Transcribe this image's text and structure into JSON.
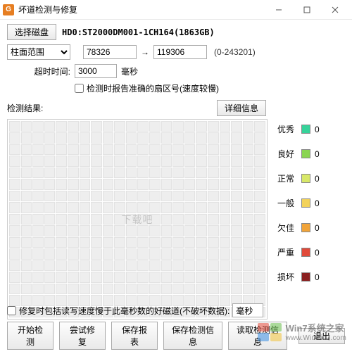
{
  "window": {
    "logo_letter": "G",
    "title": "坏道检测与修复"
  },
  "toolbar": {
    "select_disk": "选择磁盘",
    "disk_name": "HD0:ST2000DM001-1CH164(1863GB)"
  },
  "range": {
    "mode_label": "柱面范围",
    "from": "78326",
    "to": "119306",
    "hint": "(0-243201)"
  },
  "timeout": {
    "label": "超时时间:",
    "value": "3000",
    "unit": "毫秒"
  },
  "report_checkbox": {
    "label": "检测时报告准确的扇区号(速度较慢)"
  },
  "result": {
    "label": "检测结果:",
    "detail_btn": "详细信息"
  },
  "legend": [
    {
      "name": "优秀",
      "color": "#36d39a",
      "count": 0
    },
    {
      "name": "良好",
      "color": "#8ad552",
      "count": 0
    },
    {
      "name": "正常",
      "color": "#d8e868",
      "count": 0
    },
    {
      "name": "一般",
      "color": "#f2d25a",
      "count": 0
    },
    {
      "name": "欠佳",
      "color": "#f1a43a",
      "count": 0
    },
    {
      "name": "严重",
      "color": "#e04a3a",
      "count": 0
    },
    {
      "name": "损坏",
      "color": "#8a2020",
      "count": 0
    }
  ],
  "grid_overlay": "下载吧",
  "repair": {
    "checkbox_label": "修复时包括读写速度慢于此毫秒数的好磁道(不破坏数据):",
    "ms_value": "毫秒",
    "unit_after": ""
  },
  "buttons": {
    "start": "开始检测",
    "try_repair": "尝试修复",
    "save_report": "保存报表",
    "save_info": "保存检测信息",
    "read_info": "读取检测信息",
    "exit": "退出"
  },
  "watermark": {
    "cn": "Win7系统之家",
    "url": "www.Winwin7.com"
  }
}
